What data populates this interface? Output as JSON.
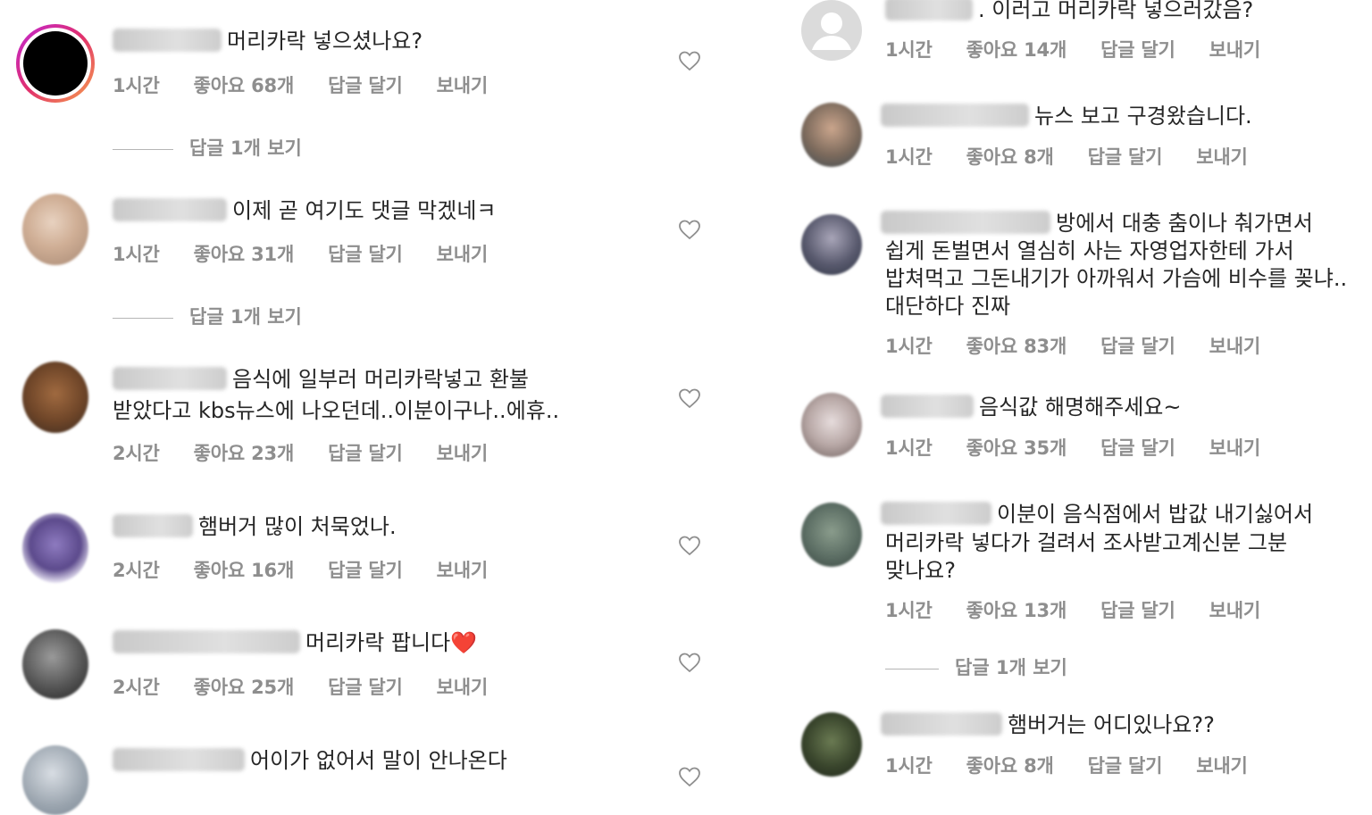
{
  "left": [
    {
      "text": "머리카락 넣으셨나요?",
      "time": "1시간",
      "likes": "좋아요 68개",
      "reply": "답글 달기",
      "send": "보내기",
      "view_replies": "답글 1개 보기"
    },
    {
      "text": "이제 곧 여기도 댓글 막겠네ㅋ",
      "time": "1시간",
      "likes": "좋아요 31개",
      "reply": "답글 달기",
      "send": "보내기",
      "view_replies": "답글 1개 보기"
    },
    {
      "text_lines": [
        "음식에 일부러 머리카락넣고 환불",
        "받았다고 kbs뉴스에 나오던데..이분이구나..에휴.."
      ],
      "time": "2시간",
      "likes": "좋아요 23개",
      "reply": "답글 달기",
      "send": "보내기"
    },
    {
      "text": "햄버거 많이 처묵었나.",
      "time": "2시간",
      "likes": "좋아요 16개",
      "reply": "답글 달기",
      "send": "보내기"
    },
    {
      "text": "머리카락 팝니다",
      "emoji": "❤️",
      "time": "2시간",
      "likes": "좋아요 25개",
      "reply": "답글 달기",
      "send": "보내기"
    },
    {
      "text": "어이가 없어서 말이 안나온다"
    }
  ],
  "right": [
    {
      "text": ". 이러고 머리카락 넣으러갔음?",
      "time": "1시간",
      "likes": "좋아요 14개",
      "reply": "답글 달기",
      "send": "보내기"
    },
    {
      "text": "뉴스 보고  구경왔습니다.",
      "time": "1시간",
      "likes": "좋아요 8개",
      "reply": "답글 달기",
      "send": "보내기"
    },
    {
      "text_lines": [
        "방에서 대충 춤이나 춰가면서",
        "쉽게 돈벌면서 열심히 사는 자영업자한테 가서",
        "밥쳐먹고 그돈내기가 아까워서 가슴에 비수를 꽂냐..",
        "대단하다 진짜"
      ],
      "time": "1시간",
      "likes": "좋아요 83개",
      "reply": "답글 달기",
      "send": "보내기"
    },
    {
      "text": "음식값 해명해주세요~",
      "time": "1시간",
      "likes": "좋아요 35개",
      "reply": "답글 달기",
      "send": "보내기"
    },
    {
      "text_lines": [
        "이분이 음식점에서 밥값 내기싫어서",
        "머리카락 넣다가 걸려서 조사받고계신분 그분",
        "맞나요?"
      ],
      "time": "1시간",
      "likes": "좋아요 13개",
      "reply": "답글 달기",
      "send": "보내기",
      "view_replies": "답글 1개 보기"
    },
    {
      "text": "햄버거는 어디있나요??",
      "time": "1시간",
      "likes": "좋아요 8개",
      "reply": "답글 달기",
      "send": "보내기"
    }
  ],
  "colors": {
    "text": "#262626",
    "meta": "#8e8e8e",
    "heart_emoji": "#e0245e"
  },
  "icons": {
    "like": "heart-outline-icon"
  }
}
